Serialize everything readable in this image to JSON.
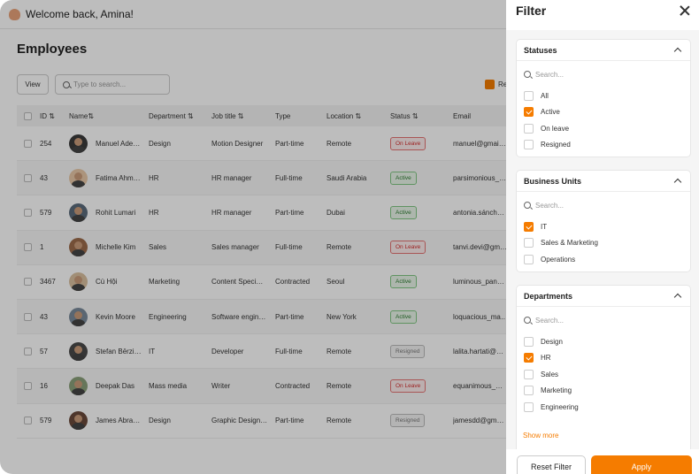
{
  "header": {
    "welcome": "Welcome back, Amina!"
  },
  "page": {
    "title": "Employees"
  },
  "toolbar": {
    "view_label": "View",
    "search_placeholder": "Type to search...",
    "partial_check_label": "Re"
  },
  "table": {
    "columns": [
      "ID",
      "Name",
      "Department",
      "Job title",
      "Type",
      "Location",
      "Status",
      "Email"
    ],
    "rows": [
      {
        "id": "254",
        "name": "Manuel Ade…",
        "department": "Design",
        "job": "Motion Designer",
        "type": "Part-time",
        "location": "Remote",
        "status": "On Leave",
        "email": "manuel@gmai…"
      },
      {
        "id": "43",
        "name": "Fatima Ahm…",
        "department": "HR",
        "job": "HR manager",
        "type": "Full-time",
        "location": "Saudi Arabia",
        "status": "Active",
        "email": "parsimonious_…"
      },
      {
        "id": "579",
        "name": "Rohit Lumari",
        "department": "HR",
        "job": "HR manager",
        "type": "Part-time",
        "location": "Dubai",
        "status": "Active",
        "email": "antonia.sánch…"
      },
      {
        "id": "1",
        "name": "Michelle Kim",
        "department": "Sales",
        "job": "Sales manager",
        "type": "Full-time",
        "location": "Remote",
        "status": "On Leave",
        "email": "tanvi.devi@gm…"
      },
      {
        "id": "3467",
        "name": "Cù Hội",
        "department": "Marketing",
        "job": "Content Speci…",
        "type": "Contracted",
        "location": "Seoul",
        "status": "Active",
        "email": "luminous_pan…"
      },
      {
        "id": "43",
        "name": "Kevin Moore",
        "department": "Engineering",
        "job": "Software engin…",
        "type": "Part-time",
        "location": "New York",
        "status": "Active",
        "email": "loquacious_ma…"
      },
      {
        "id": "57",
        "name": "Stefan Bērzi…",
        "department": "IT",
        "job": "Developer",
        "type": "Full-time",
        "location": "Remote",
        "status": "Resigned",
        "email": "lalita.hartati@…"
      },
      {
        "id": "16",
        "name": "Deepak Das",
        "department": "Mass media",
        "job": "Writer",
        "type": "Contracted",
        "location": "Remote",
        "status": "On Leave",
        "email": "equanimous_…"
      },
      {
        "id": "579",
        "name": "James Abra…",
        "department": "Design",
        "job": "Graphic Design…",
        "type": "Part-time",
        "location": "Remote",
        "status": "Resigned",
        "email": "jamesdd@gm…"
      }
    ]
  },
  "filter": {
    "title": "Filter",
    "search_placeholder": "Search...",
    "statuses": {
      "title": "Statuses",
      "options": [
        {
          "label": "All",
          "checked": false
        },
        {
          "label": "Active",
          "checked": true
        },
        {
          "label": "On leave",
          "checked": false
        },
        {
          "label": "Resigned",
          "checked": false
        }
      ]
    },
    "business_units": {
      "title": "Business Units",
      "options": [
        {
          "label": "IT",
          "checked": true
        },
        {
          "label": "Sales & Marketing",
          "checked": false
        },
        {
          "label": "Operations",
          "checked": false
        }
      ]
    },
    "departments": {
      "title": "Departments",
      "options": [
        {
          "label": "Design",
          "checked": false
        },
        {
          "label": "HR",
          "checked": true
        },
        {
          "label": "Sales",
          "checked": false
        },
        {
          "label": "Marketing",
          "checked": false
        },
        {
          "label": "Engineering",
          "checked": false
        }
      ]
    },
    "show_more": "Show more",
    "reset_label": "Reset Filter",
    "apply_label": "Apply"
  },
  "colors": {
    "accent": "#f57c00",
    "overlay": "rgba(0,0,0,0.26)"
  }
}
